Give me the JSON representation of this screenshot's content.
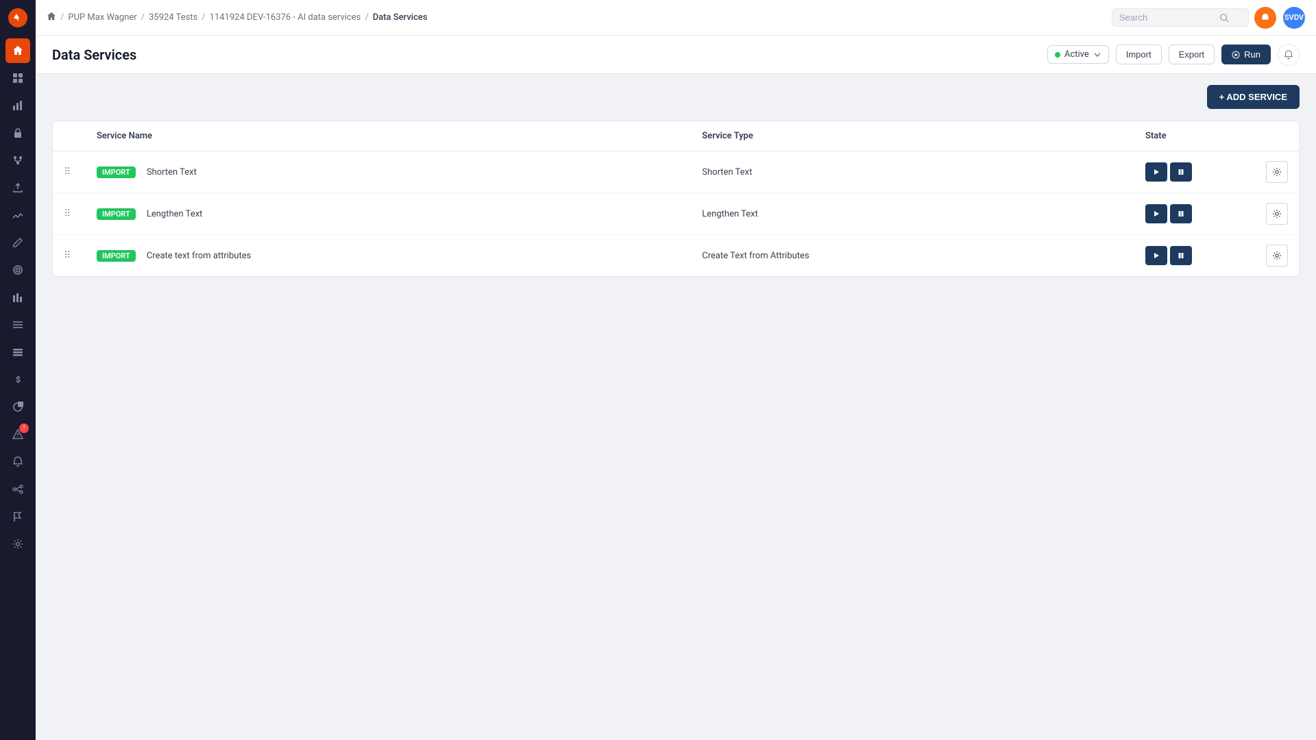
{
  "sidebar": {
    "logo": "⚡",
    "items": [
      {
        "id": "home",
        "icon": "⊞",
        "active": true
      },
      {
        "id": "grid",
        "icon": "⊞"
      },
      {
        "id": "chart",
        "icon": "📊"
      },
      {
        "id": "lock",
        "icon": "🔒"
      },
      {
        "id": "git",
        "icon": "⑂"
      },
      {
        "id": "upload",
        "icon": "↑"
      },
      {
        "id": "analytics",
        "icon": "📈"
      },
      {
        "id": "pencil",
        "icon": "✏"
      },
      {
        "id": "target",
        "icon": "◎"
      },
      {
        "id": "bar-chart",
        "icon": "▦"
      },
      {
        "id": "list",
        "icon": "≡"
      },
      {
        "id": "list2",
        "icon": "≡"
      },
      {
        "id": "dollar",
        "icon": "$"
      },
      {
        "id": "pie",
        "icon": "◔"
      },
      {
        "id": "alert",
        "icon": "!",
        "badge": "!"
      },
      {
        "id": "bell",
        "icon": "🔔"
      },
      {
        "id": "settings2",
        "icon": "⚙"
      },
      {
        "id": "flag",
        "icon": "⚑"
      },
      {
        "id": "settings",
        "icon": "⚙"
      }
    ]
  },
  "topbar": {
    "breadcrumb": [
      {
        "label": "PUP Max Wagner",
        "link": true
      },
      {
        "label": "35924 Tests",
        "link": true
      },
      {
        "label": "1141924 DEV-16376 - AI data services",
        "link": true
      },
      {
        "label": "Data Services",
        "current": true
      }
    ],
    "search": {
      "placeholder": "Search"
    },
    "avatar": "SVDV"
  },
  "page": {
    "title": "Data Services",
    "status": {
      "label": "Active",
      "color": "#22c55e"
    },
    "actions": {
      "import_label": "Import",
      "export_label": "Export",
      "run_label": "Run",
      "add_service_label": "+ ADD SERVICE"
    }
  },
  "table": {
    "columns": [
      {
        "id": "drag",
        "label": ""
      },
      {
        "id": "name",
        "label": "Service Name"
      },
      {
        "id": "type",
        "label": "Service Type"
      },
      {
        "id": "state",
        "label": "State"
      },
      {
        "id": "actions",
        "label": ""
      }
    ],
    "rows": [
      {
        "id": 1,
        "badge": "import",
        "name": "Shorten Text",
        "type": "Shorten Text"
      },
      {
        "id": 2,
        "badge": "import",
        "name": "Lengthen Text",
        "type": "Lengthen Text"
      },
      {
        "id": 3,
        "badge": "import",
        "name": "Create text from attributes",
        "type": "Create Text from Attributes"
      }
    ]
  }
}
